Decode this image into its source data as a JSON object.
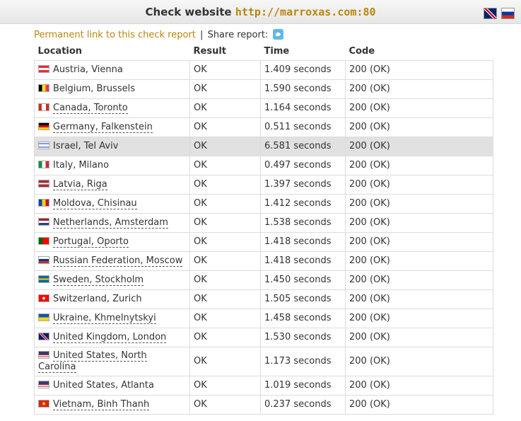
{
  "header": {
    "title_prefix": "Check website",
    "url": "http://marroxas.com:80"
  },
  "links": {
    "permanent": "Permanent link to this check report",
    "separator": "|",
    "share": "Share report:"
  },
  "table": {
    "headers": [
      "Location",
      "Result",
      "Time",
      "Code"
    ],
    "rows": [
      {
        "location": "Austria, Vienna",
        "result": "OK",
        "time": "1.409 seconds",
        "code": "200 (OK)",
        "linked": false
      },
      {
        "location": "Belgium, Brussels",
        "result": "OK",
        "time": "1.590 seconds",
        "code": "200 (OK)",
        "linked": false
      },
      {
        "location": "Canada, Toronto",
        "result": "OK",
        "time": "1.164 seconds",
        "code": "200 (OK)",
        "linked": true
      },
      {
        "location": "Germany, Falkenstein",
        "result": "OK",
        "time": "0.511 seconds",
        "code": "200 (OK)",
        "linked": true
      },
      {
        "location": "Israel, Tel Aviv",
        "result": "OK",
        "time": "6.581 seconds",
        "code": "200 (OK)",
        "linked": false,
        "highlight": true
      },
      {
        "location": "Italy, Milano",
        "result": "OK",
        "time": "0.497 seconds",
        "code": "200 (OK)",
        "linked": false
      },
      {
        "location": "Latvia, Riga",
        "result": "OK",
        "time": "1.397 seconds",
        "code": "200 (OK)",
        "linked": true
      },
      {
        "location": "Moldova, Chisinau",
        "result": "OK",
        "time": "1.412 seconds",
        "code": "200 (OK)",
        "linked": true
      },
      {
        "location": "Netherlands, Amsterdam",
        "result": "OK",
        "time": "1.538 seconds",
        "code": "200 (OK)",
        "linked": true
      },
      {
        "location": "Portugal, Oporto",
        "result": "OK",
        "time": "1.418 seconds",
        "code": "200 (OK)",
        "linked": true
      },
      {
        "location": "Russian Federation, Moscow",
        "result": "OK",
        "time": "1.418 seconds",
        "code": "200 (OK)",
        "linked": true
      },
      {
        "location": "Sweden, Stockholm",
        "result": "OK",
        "time": "1.450 seconds",
        "code": "200 (OK)",
        "linked": true
      },
      {
        "location": "Switzerland, Zurich",
        "result": "OK",
        "time": "1.505 seconds",
        "code": "200 (OK)",
        "linked": false
      },
      {
        "location": "Ukraine, Khmelnytskyi",
        "result": "OK",
        "time": "1.458 seconds",
        "code": "200 (OK)",
        "linked": true
      },
      {
        "location": "United Kingdom, London",
        "result": "OK",
        "time": "1.530 seconds",
        "code": "200 (OK)",
        "linked": true
      },
      {
        "location": "United States, North Carolina",
        "result": "OK",
        "time": "1.173 seconds",
        "code": "200 (OK)",
        "linked": true
      },
      {
        "location": "United States, Atlanta",
        "result": "OK",
        "time": "1.019 seconds",
        "code": "200 (OK)",
        "linked": false
      },
      {
        "location": "Vietnam, Binh Thanh",
        "result": "OK",
        "time": "0.237 seconds",
        "code": "200 (OK)",
        "linked": true
      }
    ]
  },
  "flags": [
    "linear-gradient(#ed2939 33%, #fff 33% 67%, #ed2939 67%)",
    "linear-gradient(90deg, #000 33%, #fdda24 33% 67%, #ef3340 67%)",
    "linear-gradient(90deg, #d52b1e 28%, #fff 28% 72%, #d52b1e 72%)",
    "linear-gradient(#000 33%, #dd0000 33% 67%, #ffce00 67%)",
    "linear-gradient(#fff 15%, #0038b8 15% 28%, #fff 28% 72%, #0038b8 72% 85%, #fff 85%)",
    "linear-gradient(90deg, #009246 33%, #fff 33% 67%, #ce2b37 67%)",
    "linear-gradient(#9e3039 40%, #fff 40% 60%, #9e3039 60%)",
    "linear-gradient(90deg, #0046ae 33%, #ffd200 33% 67%, #cc092f 67%)",
    "linear-gradient(#ae1c28 33%, #fff 33% 67%, #21468b 67%)",
    "linear-gradient(90deg, #006600 40%, #ff0000 40%)",
    "linear-gradient(#fff 33%, #0039a6 33% 67%, #d52b1e 67%)",
    "linear-gradient(#006aa7 40%, #fecc00 40% 60%, #006aa7 60%)",
    "radial-gradient(circle, #fff 22%, #ff0000 23%)",
    "linear-gradient(#0057b7 50%, #ffd700 50%)",
    "linear-gradient(45deg, #012169 40%, #fff 40% 45%, #c8102e 45% 55%, #fff 55% 60%, #012169 60%)",
    "linear-gradient(#3c3b6e 45%, #b22234 45% 55%, #fff 55% 70%, #b22234 70% 85%, #fff 85%)",
    "linear-gradient(#3c3b6e 45%, #b22234 45% 55%, #fff 55% 70%, #b22234 70% 85%, #fff 85%)",
    "radial-gradient(circle, #ffcd00 25%, #da251d 26%)"
  ],
  "colors": {
    "accent": "#b8860b",
    "highlight_row": "#e1e1e1",
    "twitter": "#5fb8ec"
  },
  "icons": {
    "language_en": "uk-flag-icon",
    "language_ru": "russia-flag-icon",
    "share": "twitter-icon"
  }
}
